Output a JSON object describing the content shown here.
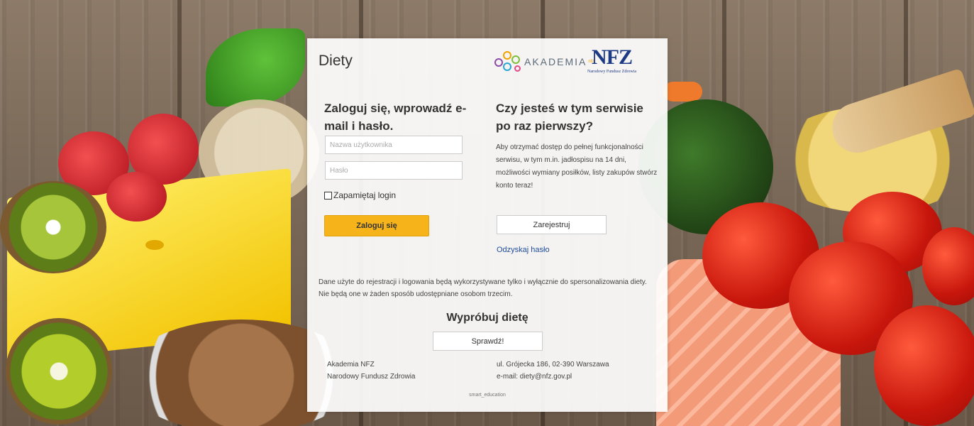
{
  "app_title": "Diety",
  "logos": {
    "akademia": "AKADEMIA",
    "akademia_sup": "nfz",
    "nfz_mark": "NFZ",
    "nfz_sub": "Narodowy Fundusz Zdrowia"
  },
  "login": {
    "heading": "Zaloguj się, wprowadź e-mail i hasło.",
    "username_placeholder": "Nazwa użytkownika",
    "password_placeholder": "Hasło",
    "remember_label": "Zapamiętaj login",
    "submit_label": "Zaloguj się"
  },
  "register": {
    "heading": "Czy jesteś w tym serwisie po raz pierwszy?",
    "text": "Aby otrzymać dostęp do pełnej funkcjonalności serwisu, w tym m.in. jadłospisu na 14 dni, możliwości wymiany posiłków, listy zakupów stwórz konto teraz!",
    "button_label": "Zarejestruj",
    "recover_link": "Odzyskaj hasło"
  },
  "privacy_note": "Dane użyte do rejestracji i logowania będą wykorzystywane tylko i wyłącznie do spersonalizowania diety. Nie będą one w żaden sposób udostępniane osobom trzecim.",
  "try_diet": {
    "heading": "Wypróbuj dietę",
    "button_label": "Sprawdź!"
  },
  "footer": {
    "org_name": "Akademia NFZ",
    "org_full": "Narodowy Fundusz Zdrowia",
    "address": "ul. Grójecka 186, 02-390 Warszawa",
    "email": "e-mail: diety@nfz.gov.pl",
    "credit": "smart_education"
  },
  "colors": {
    "login_button": "#f6b31a",
    "link": "#1f4d9a",
    "nfz_blue": "#1d3a84"
  }
}
